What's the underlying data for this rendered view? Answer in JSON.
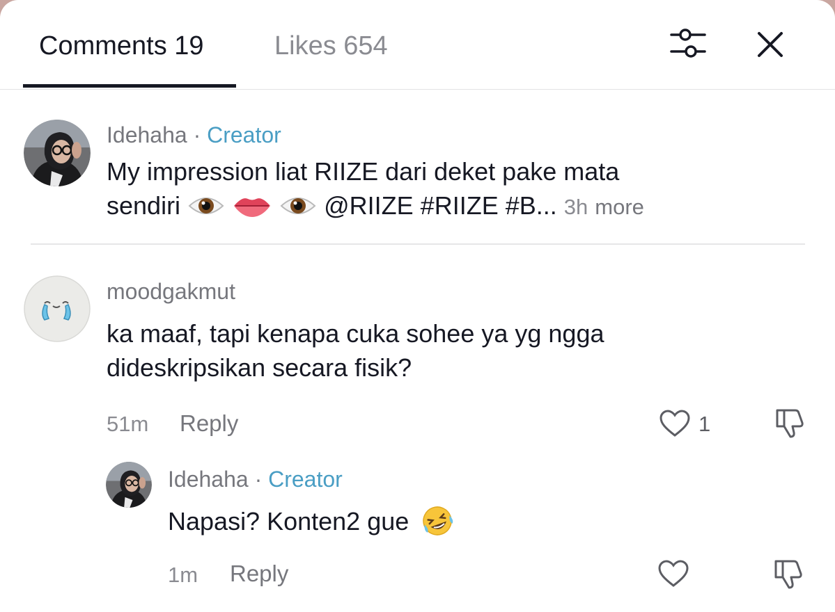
{
  "header": {
    "tab_comments": "Comments 19",
    "tab_likes": "Likes 654",
    "filter_icon": "sliders-icon",
    "close_icon": "close-icon"
  },
  "comments": [
    {
      "username": "Idehaha",
      "separator": " · ",
      "badge": "Creator",
      "text_line1": "My impression liat RIIZE dari deket pake mata",
      "text_line2_start": "sendiri",
      "emojis": [
        "eye-emoji",
        "lips-emoji",
        "eye-emoji"
      ],
      "text_line2_end": "@RIIZE #RIIZE #B...",
      "time": "3h",
      "more": "more"
    },
    {
      "username": "moodgakmut",
      "text_line1": "ka maaf, tapi kenapa cuka sohee ya yg ngga",
      "text_line2": "dideskripsikan secara fisik?",
      "time": "51m",
      "reply": "Reply",
      "like_count": "1"
    },
    {
      "username": "Idehaha",
      "separator": " · ",
      "badge": "Creator",
      "text": "Napasi? Konten2 gue",
      "emoji": "rofl-emoji",
      "time": "1m",
      "reply": "Reply"
    }
  ],
  "colors": {
    "creator": "#4a9ec4",
    "primary_text": "#161823",
    "secondary_text": "#8a8b91",
    "background_top": "#c9a6a0"
  }
}
